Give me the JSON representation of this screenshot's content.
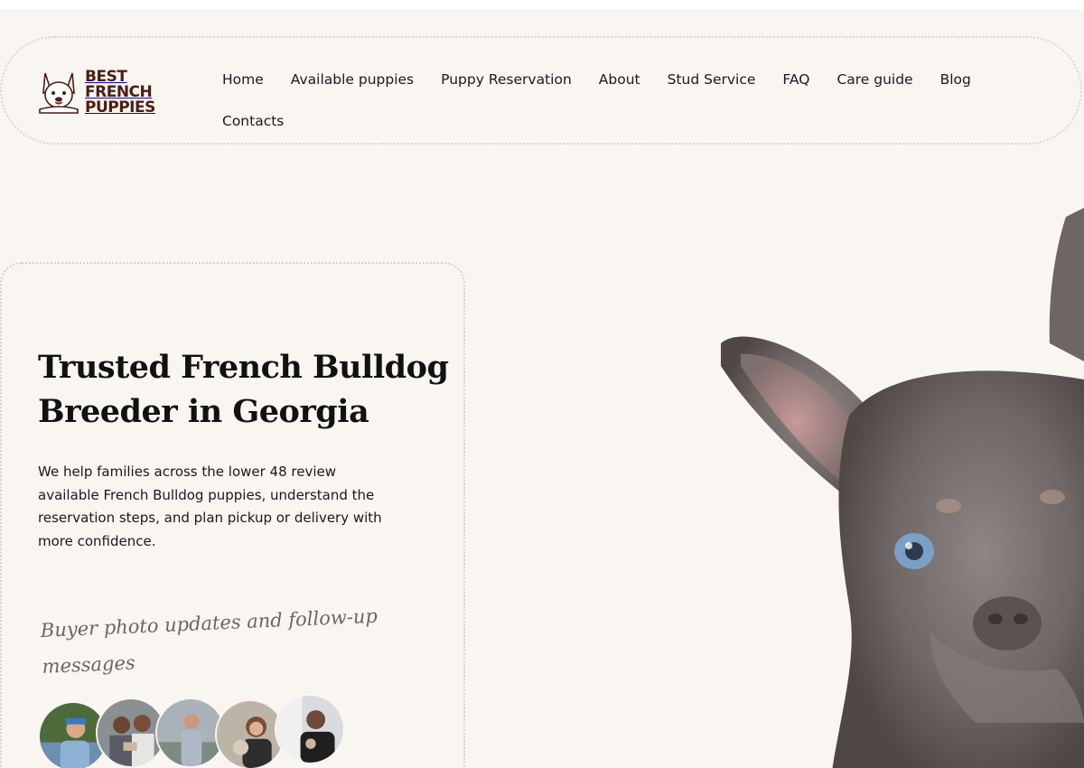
{
  "brand": {
    "logo_line1": "BEST",
    "logo_line2": "FRENCH",
    "logo_line3": "PUPPIES",
    "color": "#4a1e12"
  },
  "nav": {
    "items": [
      {
        "label": "Home"
      },
      {
        "label": "Available puppies"
      },
      {
        "label": "Puppy Reservation"
      },
      {
        "label": "About"
      },
      {
        "label": "Stud Service"
      },
      {
        "label": "FAQ"
      },
      {
        "label": "Care guide"
      },
      {
        "label": "Blog"
      },
      {
        "label": "Contacts"
      }
    ]
  },
  "hero": {
    "title": "Trusted French Bulldog Breeder in Georgia",
    "description": "We help families across the lower 48 review available French Bulldog puppies, understand the reservation steps, and plan pickup or delivery with more confidence.",
    "script_text": "Buyer photo updates and follow-up messages",
    "avatar_count": 5
  },
  "theme": {
    "background": "#f9f5f1",
    "border": "#dcd6d0",
    "text": "#1a1a1a"
  }
}
